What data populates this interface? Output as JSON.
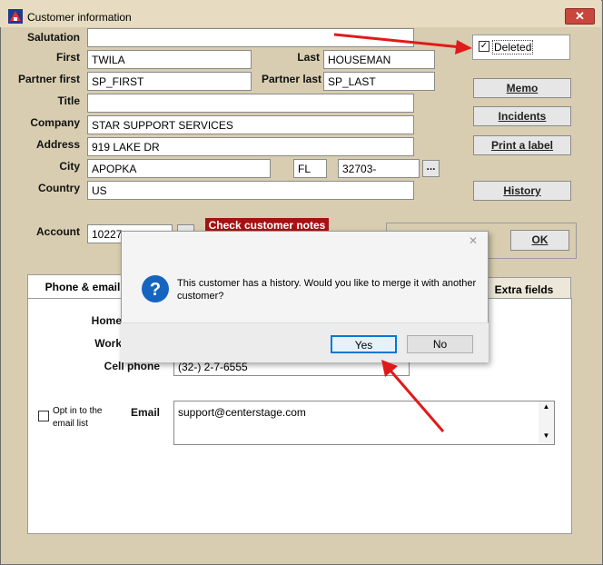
{
  "window": {
    "title": "Customer information",
    "close_glyph": "✕"
  },
  "labels": {
    "salutation": "Salutation",
    "first": "First",
    "last": "Last",
    "partner_first": "Partner first",
    "partner_last": "Partner last",
    "title": "Title",
    "company": "Company",
    "address": "Address",
    "city": "City",
    "country": "Country",
    "account": "Account"
  },
  "values": {
    "salutation": "",
    "first": "TWILA",
    "last": "HOUSEMAN",
    "partner_first": "SP_FIRST",
    "partner_last": "SP_LAST",
    "title": "",
    "company": "STAR SUPPORT SERVICES",
    "address": "919 LAKE DR",
    "city": "APOPKA",
    "state": "FL",
    "zip": "32703-",
    "country": "US",
    "account": "10227"
  },
  "buttons": {
    "memo": "Memo",
    "incidents": "Incidents",
    "print_label": "Print a label",
    "history": "History",
    "ok": "OK",
    "zip_browse": "..."
  },
  "deleted": {
    "label": "Deleted",
    "checked": true,
    "check_glyph": "✓"
  },
  "badge": {
    "text": "Check customer notes",
    "color": "#a51212"
  },
  "tabs": {
    "phone_email": "Phone & email",
    "extra_fields": "Extra fields"
  },
  "phone": {
    "home_label": "Home",
    "work_label": "Work",
    "cell_label": "Cell phone",
    "cell_value": "(32-) 2-7-6555"
  },
  "optin": {
    "label_line1": "Opt in to the",
    "label_line2": "email list"
  },
  "email": {
    "label": "Email",
    "value": "support@centerstage.com"
  },
  "dialog": {
    "message": "This customer has a history. Would you like to merge it with another customer?",
    "yes": "Yes",
    "no": "No",
    "icon_glyph": "?",
    "close_glyph": "✕"
  },
  "scroll": {
    "up": "▲",
    "down": "▼"
  },
  "colors": {
    "window_bg": "#d8cdb0",
    "arrow": "#e01a1a",
    "dialog_icon": "#1565c0"
  }
}
